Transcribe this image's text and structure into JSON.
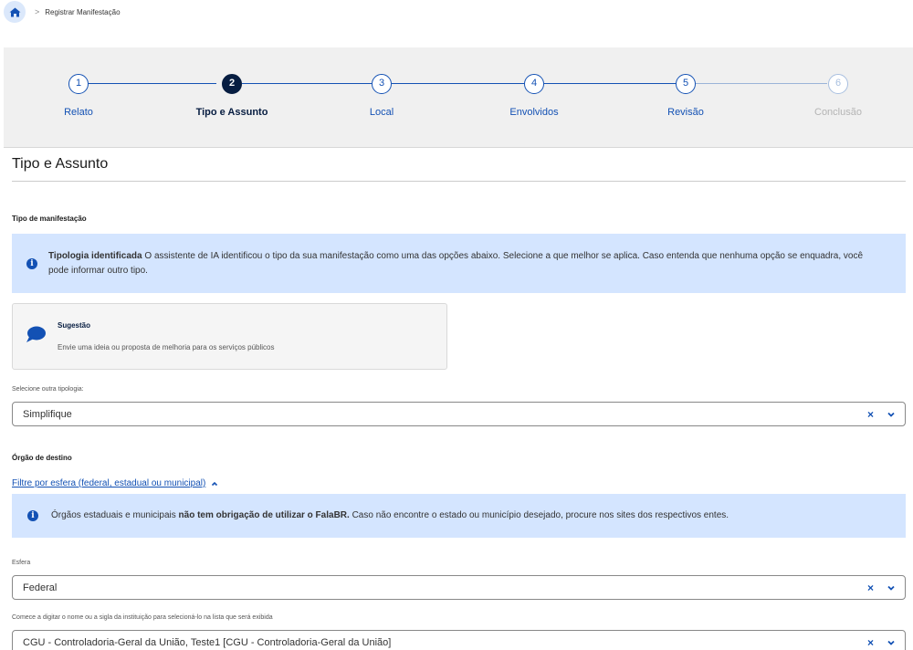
{
  "breadcrumb": {
    "home_icon": "home-icon",
    "separator": ">",
    "current": "Registrar Manifestação"
  },
  "stepper": {
    "steps": [
      {
        "number": "1",
        "label": "Relato",
        "state": "completed"
      },
      {
        "number": "2",
        "label": "Tipo e Assunto",
        "state": "active"
      },
      {
        "number": "3",
        "label": "Local",
        "state": "pending"
      },
      {
        "number": "4",
        "label": "Envolvidos",
        "state": "pending"
      },
      {
        "number": "5",
        "label": "Revisão",
        "state": "pending"
      },
      {
        "number": "6",
        "label": "Conclusão",
        "state": "disabled"
      }
    ]
  },
  "page": {
    "title": "Tipo e Assunto"
  },
  "tipo": {
    "section_label": "Tipo de manifestação",
    "info_bold": "Tipologia identificada",
    "info_text": " O assistente de IA identificou o tipo da sua manifestação como uma das opções abaixo. Selecione a que melhor se aplica. Caso entenda que nenhuma opção se enquadra, você pode informar outro tipo.",
    "suggestion": {
      "icon": "speech-bubble-icon",
      "title": "Sugestão",
      "description": "Envie uma ideia ou proposta de melhoria para os serviços públicos"
    },
    "other_label": "Selecione outra tipologia:",
    "other_value": "Simplifique"
  },
  "orgao": {
    "section_label": "Órgão de destino",
    "filter_link": "Filtre por esfera (federal, estadual ou municipal)",
    "info_pre": "Órgãos estaduais e municipais ",
    "info_bold": "não tem obrigação de utilizar o FalaBR.",
    "info_post": " Caso não encontre o estado ou município desejado, procure nos sites dos respectivos entes.",
    "esfera_label": "Esfera",
    "esfera_value": "Federal",
    "institution_label": "Comece a digitar o nome ou a sigla da instituição para selecioná-lo na lista que será exibida",
    "institution_value": "CGU - Controladoria-Geral da União, Teste1 [CGU - Controladoria-Geral da União]"
  },
  "controls": {
    "clear_symbol": "×"
  },
  "colors": {
    "primary": "#1351b4",
    "dark": "#071d41",
    "info_bg": "#d4e5ff",
    "stepper_bg": "#f0f0f0"
  }
}
